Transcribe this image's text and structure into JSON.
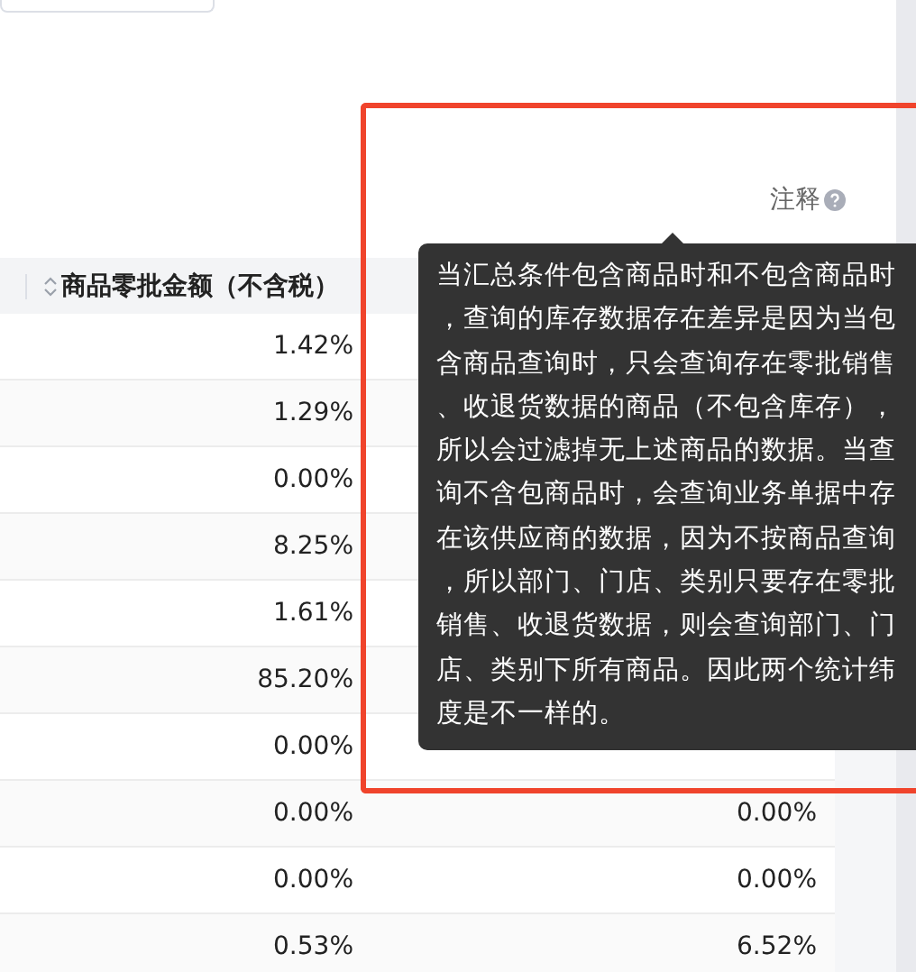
{
  "note": {
    "label": "注释"
  },
  "table": {
    "columns": [
      {
        "label": "商品零批金额（不含税）",
        "sortable": true
      }
    ],
    "rows": [
      [
        "1.42%"
      ],
      [
        "1.29%"
      ],
      [
        "0.00%"
      ],
      [
        "8.25%"
      ],
      [
        "1.61%"
      ],
      [
        "85.20%"
      ],
      [
        "0.00%"
      ],
      [
        "0.00%",
        "0.00%"
      ],
      [
        "0.00%",
        "0.00%"
      ],
      [
        "0.53%",
        "6.52%"
      ]
    ]
  },
  "tooltip": {
    "text": "当汇总条件包含商品时和不包含商品时，查询的库存数据存在差异是因为当包含商品查询时，只会查询存在零批销售、收退货数据的商品（不包含库存），所以会过滤掉无上述商品的数据。当查询不含包商品时，会查询业务单据中存在该供应商的数据，因为不按商品查询，所以部门、门店、类别只要存在零批销售、收退货数据，则会查询部门、门店、类别下所有商品。因此两个统计纬度是不一样的。"
  }
}
